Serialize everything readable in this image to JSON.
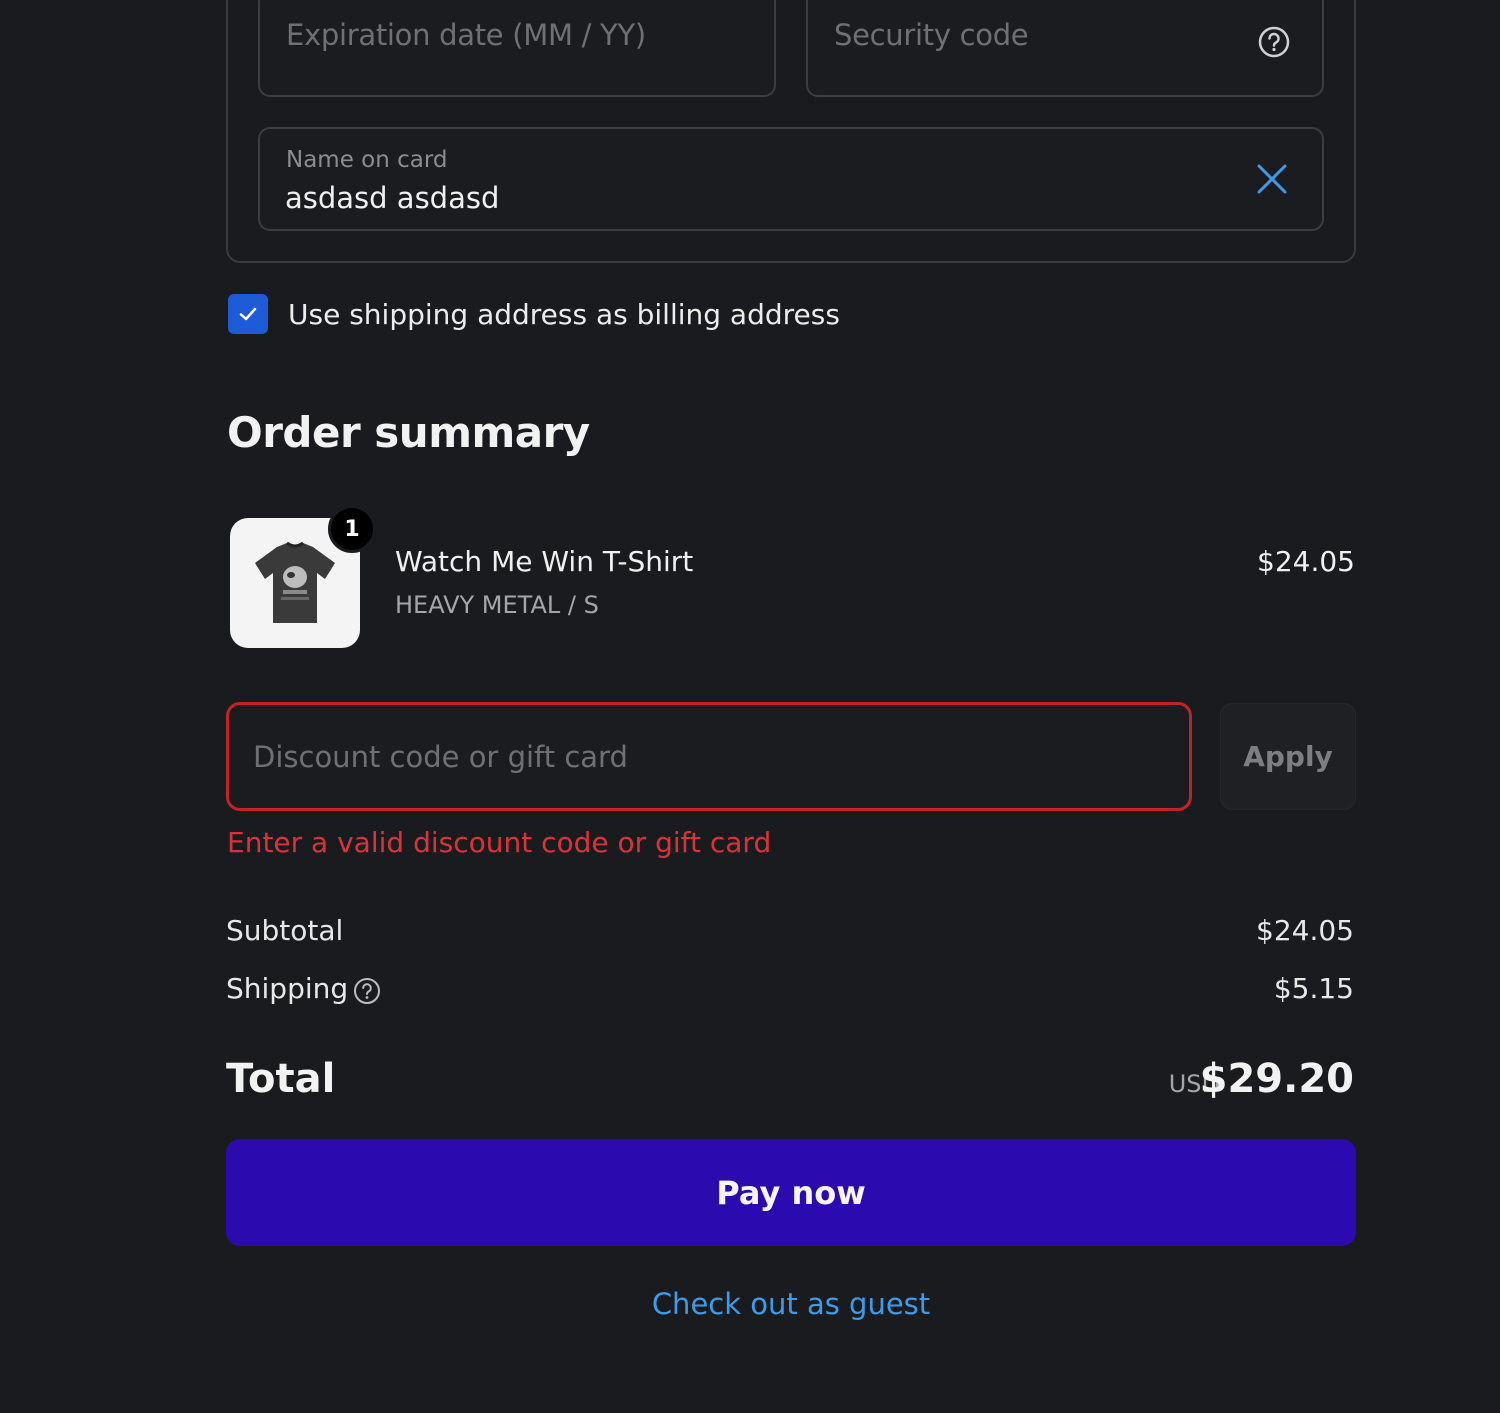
{
  "payment": {
    "expiration_placeholder": "Expiration date (MM / YY)",
    "security_placeholder": "Security code",
    "name_label": "Name on card",
    "name_value": "asdasd asdasd"
  },
  "billing": {
    "same_as_shipping_label": "Use shipping address as billing address",
    "checked": true
  },
  "summary": {
    "title": "Order summary",
    "items": [
      {
        "quantity": "1",
        "name": "Watch Me Win T-Shirt",
        "variant": "HEAVY METAL / S",
        "price": "$24.05",
        "image_icon": "tshirt-icon"
      }
    ],
    "discount": {
      "placeholder": "Discount code or gift card",
      "value": "",
      "apply_label": "Apply",
      "error": "Enter a valid discount code or gift card"
    },
    "subtotal_label": "Subtotal",
    "subtotal_value": "$24.05",
    "shipping_label": "Shipping",
    "shipping_value": "$5.15",
    "total_label": "Total",
    "total_currency": "USD",
    "total_value": "$29.20"
  },
  "actions": {
    "pay_label": "Pay now",
    "guest_label": "Check out as guest"
  },
  "colors": {
    "background": "#1a1b1e",
    "accent_pay": "#2b0bb0",
    "link": "#3d9be9",
    "error": "#d9333a",
    "checkbox": "#1e5bd6"
  }
}
